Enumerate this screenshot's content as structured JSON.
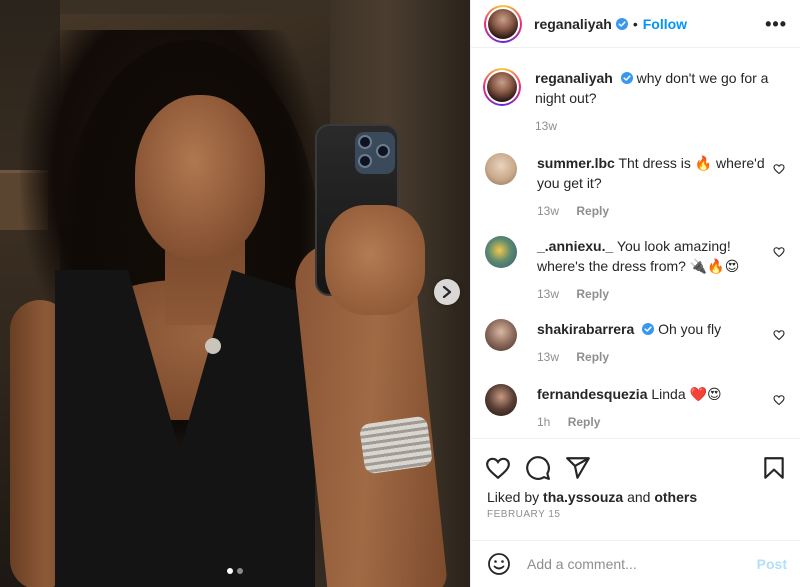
{
  "post": {
    "carousel_dots": 2,
    "active_dot": 0
  },
  "header": {
    "username": "reganaliyah",
    "separator": "•",
    "follow_label": "Follow",
    "more_label": "•••"
  },
  "caption": {
    "username": "reganaliyah",
    "text": "why don't we go for a night out?",
    "time": "13w"
  },
  "comments": [
    {
      "username": "summer.lbc",
      "verified": false,
      "text": "Tht dress is 🔥 where'd you get it?",
      "time": "13w",
      "reply_label": "Reply",
      "avatar_color": "#c9a98a"
    },
    {
      "username": "_.anniexu._",
      "verified": false,
      "text": "You look amazing! where's the dress from? 🔌🔥😍",
      "time": "13w",
      "reply_label": "Reply",
      "avatar_color": "#5f8a6e"
    },
    {
      "username": "shakirabarrera",
      "verified": true,
      "text": "Oh you fly",
      "time": "13w",
      "reply_label": "Reply",
      "avatar_color": "#6e5a4e"
    },
    {
      "username": "fernandesquezia",
      "verified": false,
      "text": "Linda ❤️😍",
      "time": "1h",
      "reply_label": "Reply",
      "avatar_color": "#3c2e2a"
    }
  ],
  "likes": {
    "prefix": "Liked by",
    "user": "tha.yssouza",
    "connector": "and",
    "others": "others"
  },
  "date": "FEBRUARY 15",
  "add_comment": {
    "placeholder": "Add a comment...",
    "post_label": "Post"
  },
  "colors": {
    "accent": "#0095f6",
    "post_disabled": "#b2dffc",
    "verified": "#3897f0"
  }
}
